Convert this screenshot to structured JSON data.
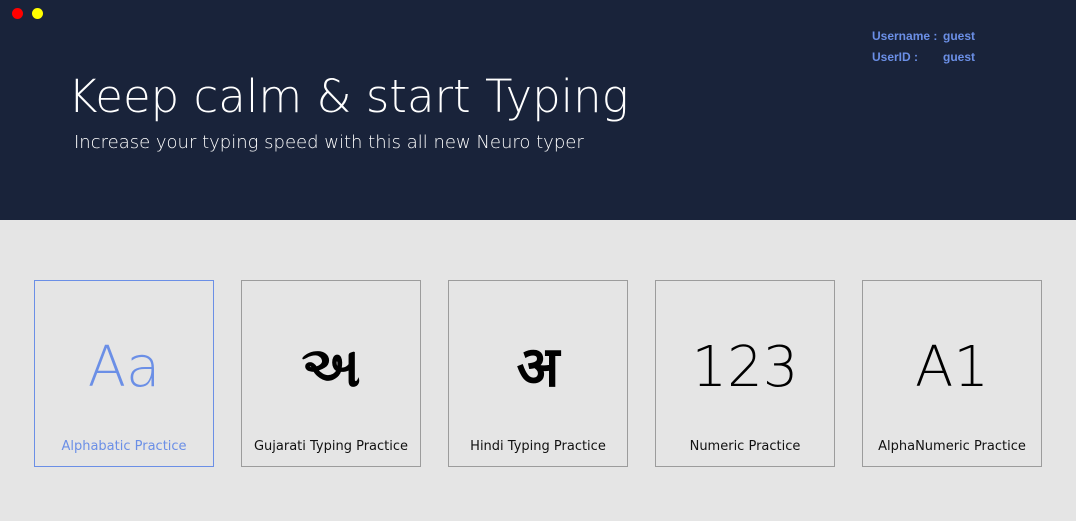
{
  "window": {
    "buttons": [
      "close",
      "minimize"
    ]
  },
  "header": {
    "title": "Keep calm & start Typing",
    "subtitle": "Increase your typing speed with this all new Neuro typer"
  },
  "user": {
    "username_label": "Username :",
    "username_value": "guest",
    "userid_label": "UserID :",
    "userid_value": "guest"
  },
  "cards": [
    {
      "glyph": "Aa",
      "label": "Alphabatic Practice",
      "selected": true
    },
    {
      "glyph": "અ",
      "label": "Gujarati Typing Practice",
      "selected": false
    },
    {
      "glyph": "अ",
      "label": "Hindi Typing Practice",
      "selected": false
    },
    {
      "glyph": "123",
      "label": "Numeric Practice",
      "selected": false
    },
    {
      "glyph": "A1",
      "label": "AlphaNumeric Practice",
      "selected": false
    }
  ],
  "colors": {
    "header_bg": "#19233a",
    "accent": "#6b8fe6",
    "body_bg": "#e5e5e5",
    "close": "#ff0000",
    "minimize": "#ffff00"
  }
}
